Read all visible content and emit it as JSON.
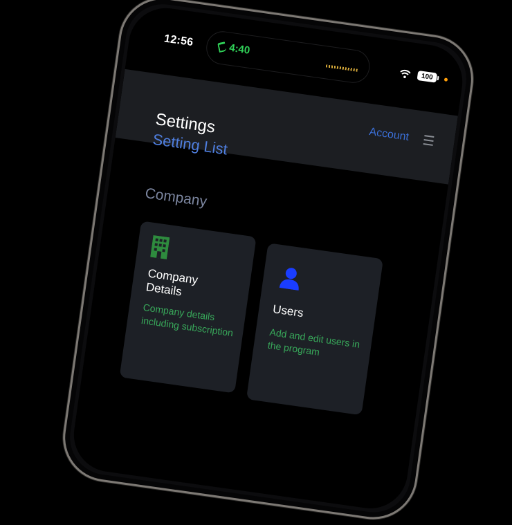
{
  "status_bar": {
    "time": "12:56",
    "call_timer": "4:40",
    "battery": "100"
  },
  "header": {
    "account_label": "Account"
  },
  "page": {
    "title": "Settings",
    "subtitle": "Setting List",
    "section": "Company"
  },
  "cards": [
    {
      "title": "Company Details",
      "description": "Company details including subscription",
      "icon": "building-icon",
      "icon_color": "#2e8b3e"
    },
    {
      "title": "Users",
      "description": "Add and edit users in the program",
      "icon": "user-icon",
      "icon_color": "#1a3dff"
    }
  ],
  "colors": {
    "accent": "#4f7fe0",
    "description_green": "#38a85a",
    "call_green": "#30d158"
  }
}
